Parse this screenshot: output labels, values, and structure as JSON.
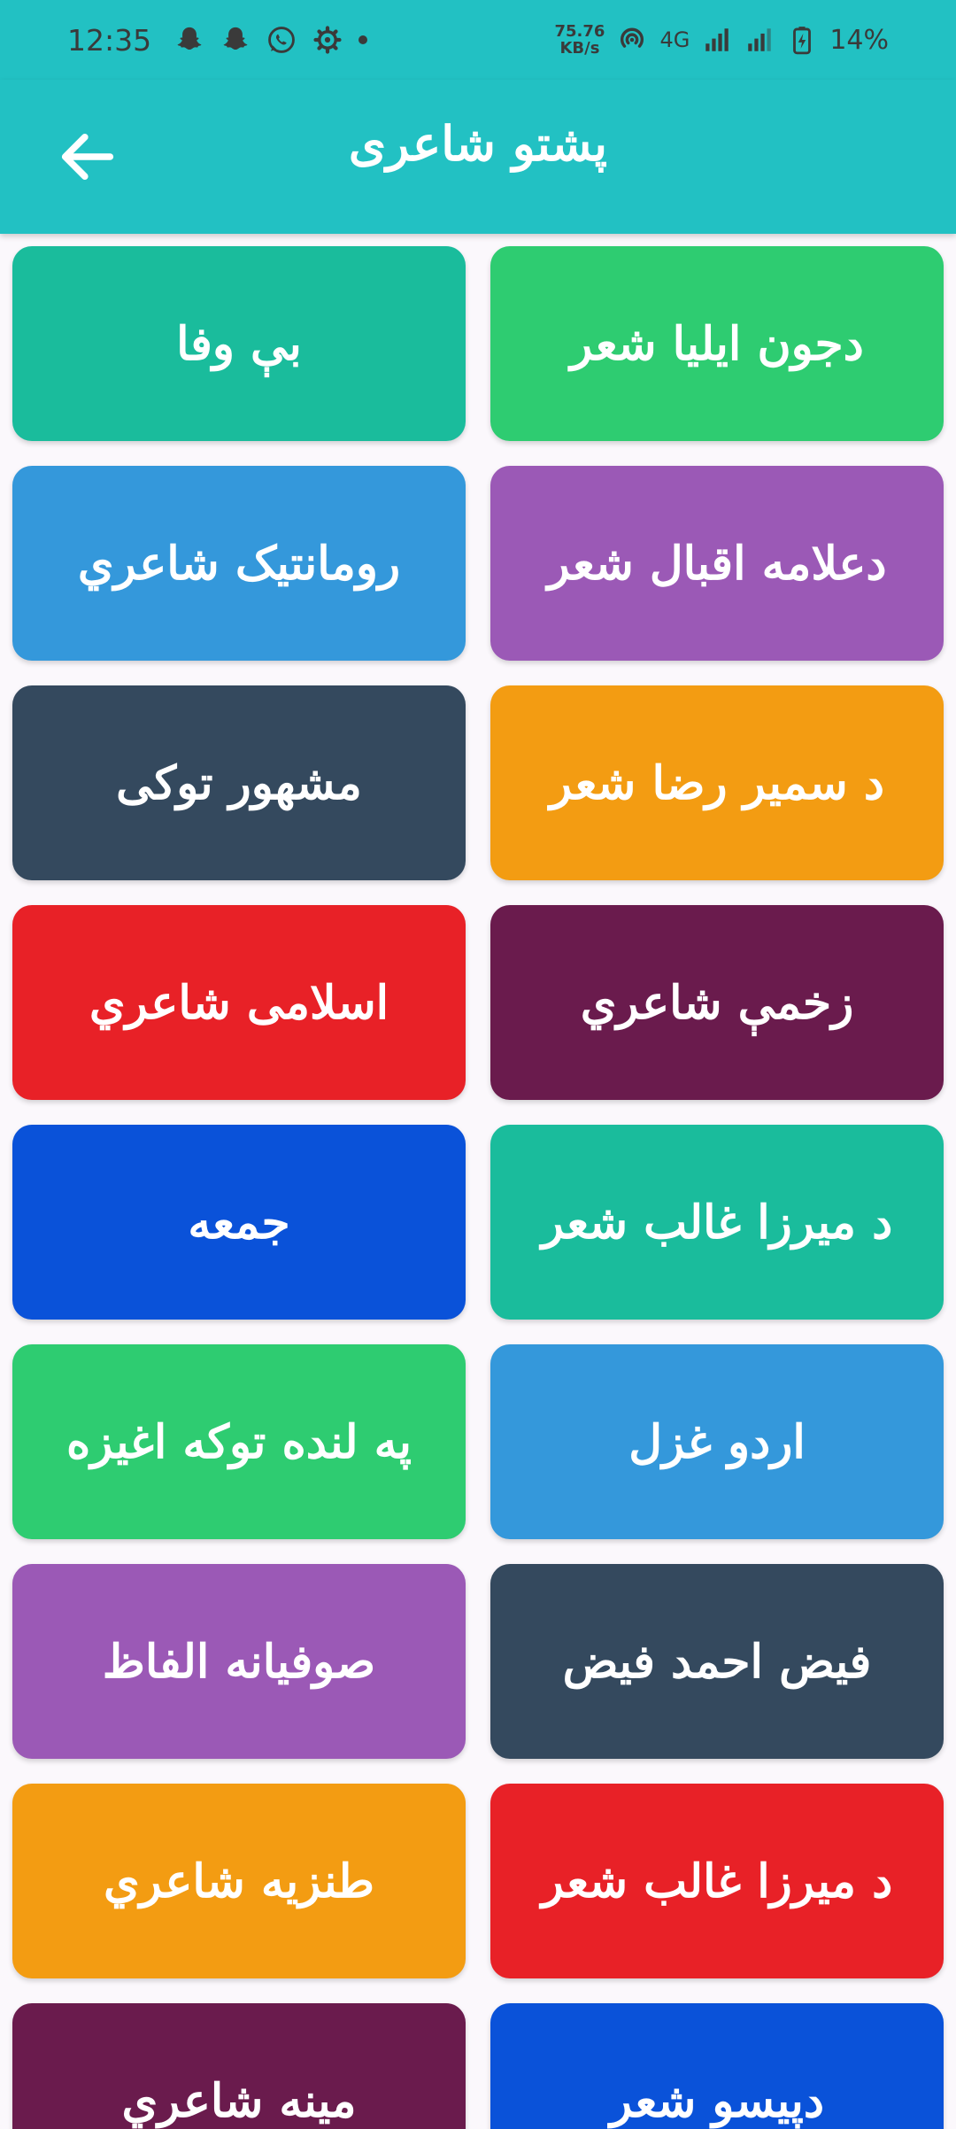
{
  "status_bar": {
    "time": "12:35",
    "left_icons": [
      "snapchat-icon",
      "snapchat-icon",
      "whatsapp-icon",
      "settings-icon",
      "dot-icon"
    ],
    "net_speed_value": "75.76",
    "net_speed_unit": "KB/s",
    "network_type": "4G",
    "battery_percent": "14%"
  },
  "app_bar": {
    "title": "پشتو شاعری",
    "back_icon": "arrow-left-icon"
  },
  "colors": {
    "app_bar": "#22c1c3",
    "teal": "#1abc9c",
    "green": "#2ecc71",
    "blue": "#3498db",
    "purple": "#9b59b6",
    "navy": "#34495e",
    "orange": "#f39c12",
    "red": "#e82127",
    "plum": "#6a1b4d",
    "royal_blue": "#0a52d9"
  },
  "cards": [
    {
      "label": "بې وفا",
      "color": "#1abc9c"
    },
    {
      "label": "دجون ایلیا شعر",
      "color": "#2ecc71"
    },
    {
      "label": "رومانتیک شاعري",
      "color": "#3498db"
    },
    {
      "label": "دعلامه اقبال شعر",
      "color": "#9b59b6"
    },
    {
      "label": "مشهور توکی",
      "color": "#34495e"
    },
    {
      "label": "د سمیر رضا شعر",
      "color": "#f39c12"
    },
    {
      "label": "اسلامی شاعري",
      "color": "#e82127"
    },
    {
      "label": "زخمې شاعري",
      "color": "#6a1b4d"
    },
    {
      "label": "جمعه",
      "color": "#0a52d9"
    },
    {
      "label": "د میرزا غالب شعر",
      "color": "#1abc9c"
    },
    {
      "label": "په لنده توکه اغیزه",
      "color": "#2ecc71"
    },
    {
      "label": "اردو غزل",
      "color": "#3498db"
    },
    {
      "label": "صوفیانه الفاظ",
      "color": "#9b59b6"
    },
    {
      "label": "فیض احمد فیض",
      "color": "#34495e"
    },
    {
      "label": "طنزیه شاعري",
      "color": "#f39c12"
    },
    {
      "label": "د میرزا غالب شعر",
      "color": "#e82127"
    },
    {
      "label": "مینه شاعري",
      "color": "#6a1b4d"
    },
    {
      "label": "دپیسو شعر",
      "color": "#0a52d9"
    }
  ]
}
